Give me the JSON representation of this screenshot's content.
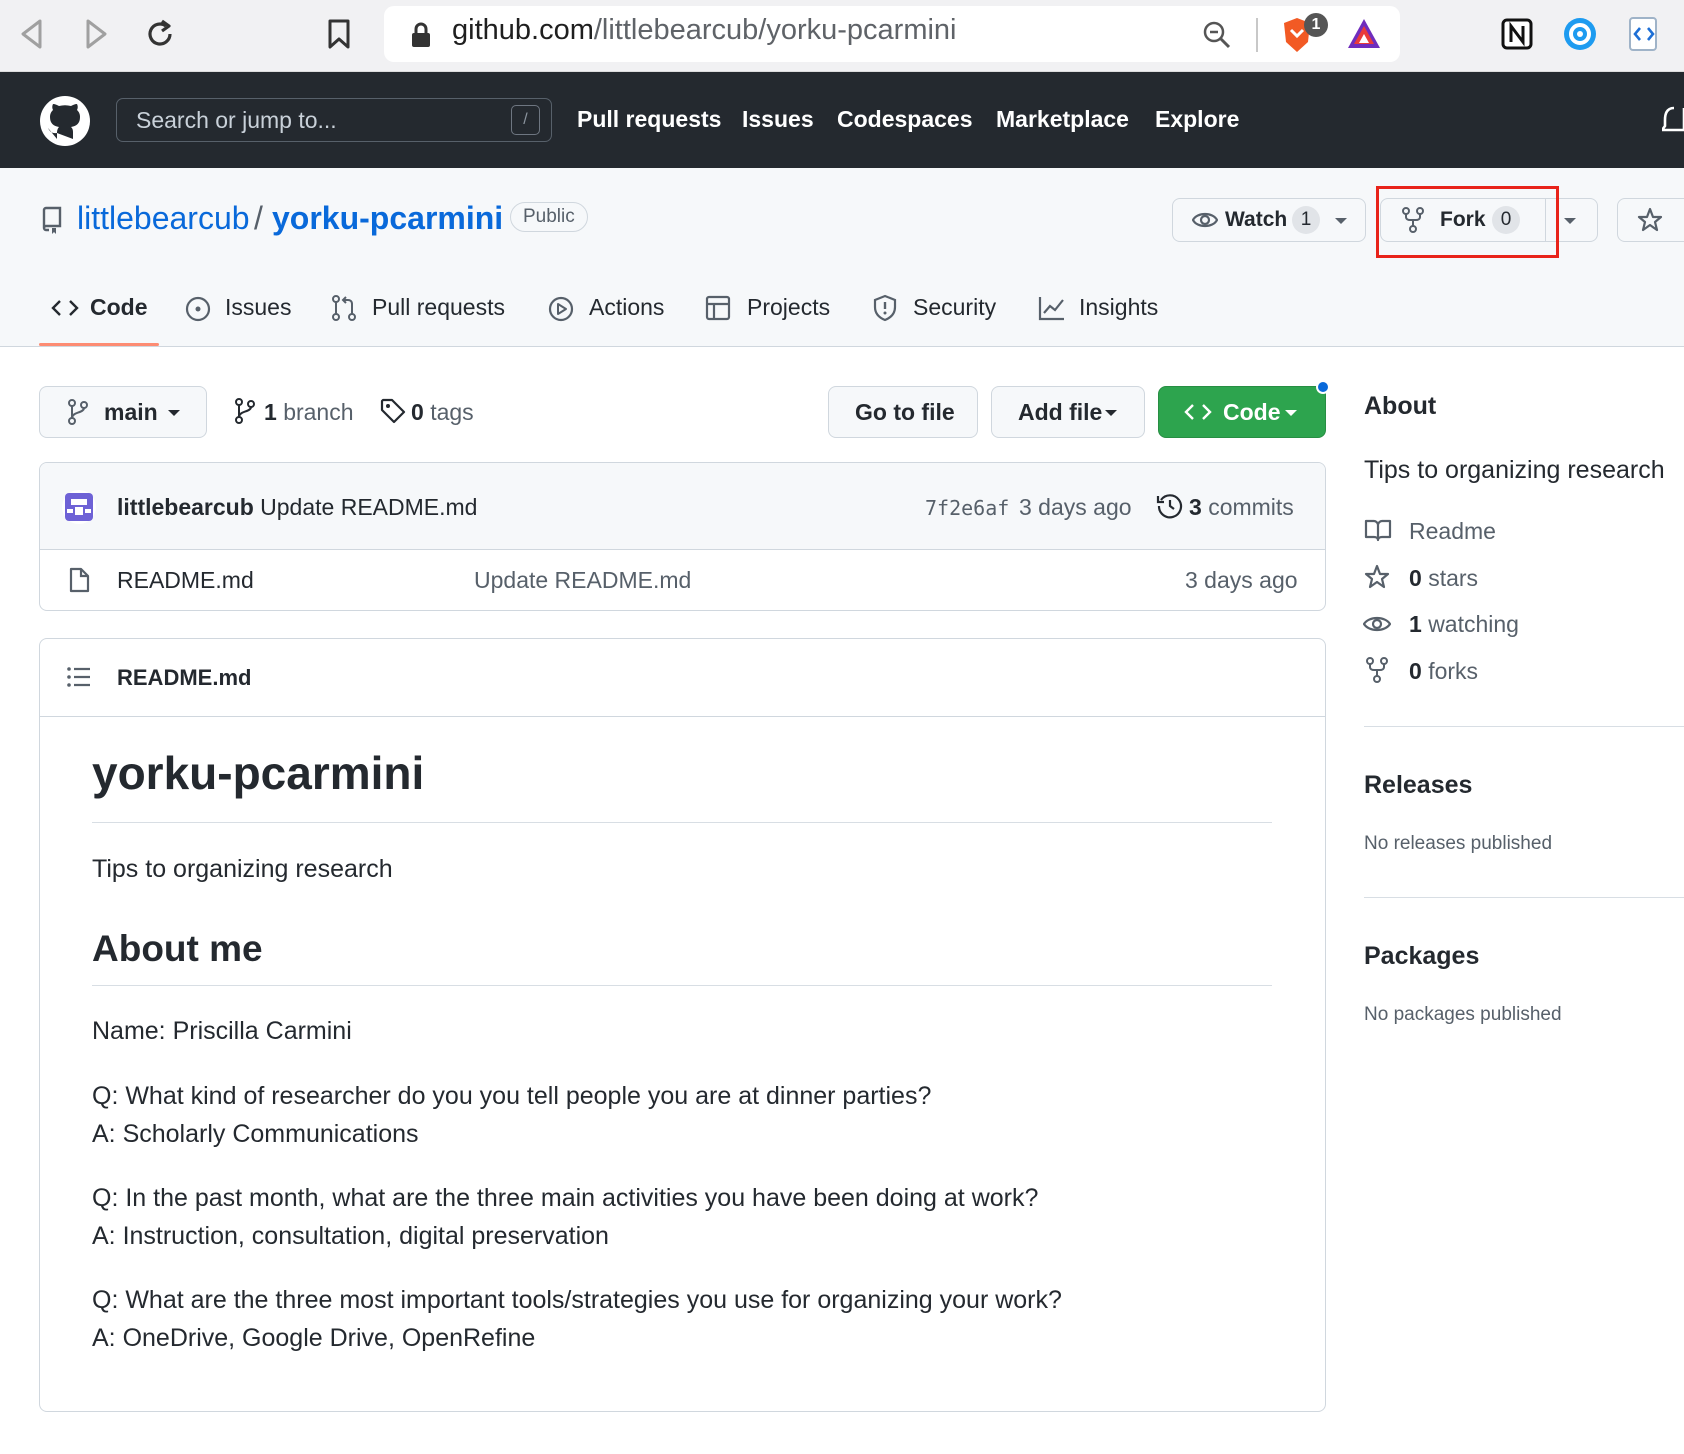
{
  "browser": {
    "url_host": "github.com",
    "url_path": "/littlebearcub/yorku-pcarmini",
    "extension_badge": "1"
  },
  "header": {
    "search_placeholder": "Search or jump to...",
    "slash_hint": "/",
    "nav": [
      "Pull requests",
      "Issues",
      "Codespaces",
      "Marketplace",
      "Explore"
    ]
  },
  "repo": {
    "owner": "littlebearcub",
    "separator": "/",
    "name": "yorku-pcarmini",
    "visibility": "Public",
    "watch_label": "Watch",
    "watch_count": "1",
    "fork_label": "Fork",
    "fork_count": "0"
  },
  "tabs": [
    "Code",
    "Issues",
    "Pull requests",
    "Actions",
    "Projects",
    "Security",
    "Insights"
  ],
  "toolbar": {
    "branch": "main",
    "branch_count": "1",
    "branch_label": "branch",
    "tags_count": "0",
    "tags_label": "tags",
    "go_to_file": "Go to file",
    "add_file": "Add file",
    "code": "Code"
  },
  "commit": {
    "author": "littlebearcub",
    "message": "Update README.md",
    "sha": "7f2e6af",
    "time": "3 days ago",
    "commits_count": "3",
    "commits_label": "commits"
  },
  "files": [
    {
      "name": "README.md",
      "message": "Update README.md",
      "time": "3 days ago"
    }
  ],
  "readme": {
    "header": "README.md",
    "title": "yorku-pcarmini",
    "tagline": "Tips to organizing research",
    "section": "About me",
    "name_line": "Name: Priscilla Carmini",
    "qa": [
      {
        "q": "Q: What kind of researcher do you you tell people you are at dinner parties?",
        "a": "A: Scholarly Communications"
      },
      {
        "q": "Q: In the past month, what are the three main activities you have been doing at work?",
        "a": "A: Instruction, consultation, digital preservation"
      },
      {
        "q": "Q: What are the three most important tools/strategies you use for organizing your work?",
        "a": "A: OneDrive, Google Drive, OpenRefine"
      }
    ]
  },
  "about": {
    "heading": "About",
    "description": "Tips to organizing research",
    "readme": "Readme",
    "stars_count": "0",
    "stars_label": "stars",
    "watching_count": "1",
    "watching_label": "watching",
    "forks_count": "0",
    "forks_label": "forks"
  },
  "releases": {
    "heading": "Releases",
    "empty": "No releases published"
  },
  "packages": {
    "heading": "Packages",
    "empty": "No packages published"
  },
  "colors": {
    "header_bg": "#24292f",
    "link_blue": "#0969da",
    "code_button_green": "#2da44e",
    "highlight_red": "#e8231a",
    "tab_underline": "#fd8c73"
  }
}
